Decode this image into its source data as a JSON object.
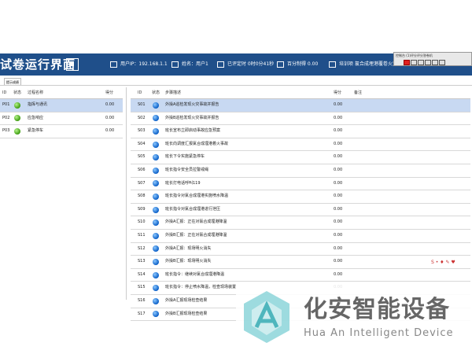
{
  "header": {
    "title": "试卷运行界面",
    "user_ip": "用户IP：192.168.1.1",
    "name": "姓名：用户1",
    "elapsed": "已评定时 0时0分41秒",
    "score": "百分制得 0.00",
    "exam": "培训项 氯合成埋港覆卷火灾"
  },
  "toolbar": {
    "title": "控制台 (1)评分评分答卷机",
    "buttons": [
      "record",
      "stop",
      "pause",
      "window",
      "close",
      "clock"
    ]
  },
  "tab": {
    "label": "提示成绩"
  },
  "left_table": {
    "columns": [
      "ID",
      "状态",
      "过程名称",
      "得分"
    ],
    "rows": [
      {
        "id": "P01",
        "status": "green",
        "name": "指挥与通讯",
        "score": "0.00",
        "selected": true
      },
      {
        "id": "P02",
        "status": "green",
        "name": "应急响应",
        "score": "0.00",
        "selected": false
      },
      {
        "id": "P03",
        "status": "green",
        "name": "紧急停车",
        "score": "0.00",
        "selected": false
      }
    ]
  },
  "right_table": {
    "columns": [
      "ID",
      "状态",
      "步骤描述",
      "得分",
      "备注"
    ],
    "rows": [
      {
        "id": "S01",
        "desc": "外操A巡检发现火灾事故并报告",
        "score": "0.00",
        "selected": true
      },
      {
        "id": "S02",
        "desc": "外操B巡检发现火灾事故并报告",
        "score": "0.00"
      },
      {
        "id": "S03",
        "desc": "班长宣布立即启动事故应急预案",
        "score": "0.00"
      },
      {
        "id": "S04",
        "desc": "班长向调度汇报氯合成埋港着火事故",
        "score": "0.00"
      },
      {
        "id": "S05",
        "desc": "班长下令实施紧急停车",
        "score": "0.00"
      },
      {
        "id": "S06",
        "desc": "班长指令安全员拉警戒绳",
        "score": "0.00"
      },
      {
        "id": "S07",
        "desc": "班长打电话呼叫119",
        "score": "0.00"
      },
      {
        "id": "S08",
        "desc": "班长指令对氯合成埋港实施喷水降温",
        "score": "0.00"
      },
      {
        "id": "S09",
        "desc": "班长指令对氯合成埋港进行泄压",
        "score": "0.00"
      },
      {
        "id": "S10",
        "desc": "外操A汇报：正在对氯合成埋港降温",
        "score": "0.00"
      },
      {
        "id": "S11",
        "desc": "外操B汇报：正在对氯合成埋港降温",
        "score": "0.00"
      },
      {
        "id": "S12",
        "desc": "外操A汇报：现场明火消失",
        "score": "0.00"
      },
      {
        "id": "S13",
        "desc": "外操B汇报：现场明火消失",
        "score": "0.00"
      },
      {
        "id": "S14",
        "desc": "班长指令：继续对氯合成埋港降温",
        "score": "0.00"
      },
      {
        "id": "S15",
        "desc": "班长指令：停止喷水降温，检查现场装置",
        "score": "0.00"
      },
      {
        "id": "S16",
        "desc": "外操A汇报现场检查结果",
        "score": "0.00"
      },
      {
        "id": "S17",
        "desc": "外操B汇报现场检查结果",
        "score": "0.00"
      }
    ]
  },
  "watermark": {
    "cn": "化安智能设备",
    "en": "Hua An Intelligent Device"
  },
  "colors": {
    "header_bg": "#1f4f8a",
    "selected_row": "#c8d9f2",
    "status_green": "#3d9b10",
    "status_blue": "#0b5fc7"
  }
}
